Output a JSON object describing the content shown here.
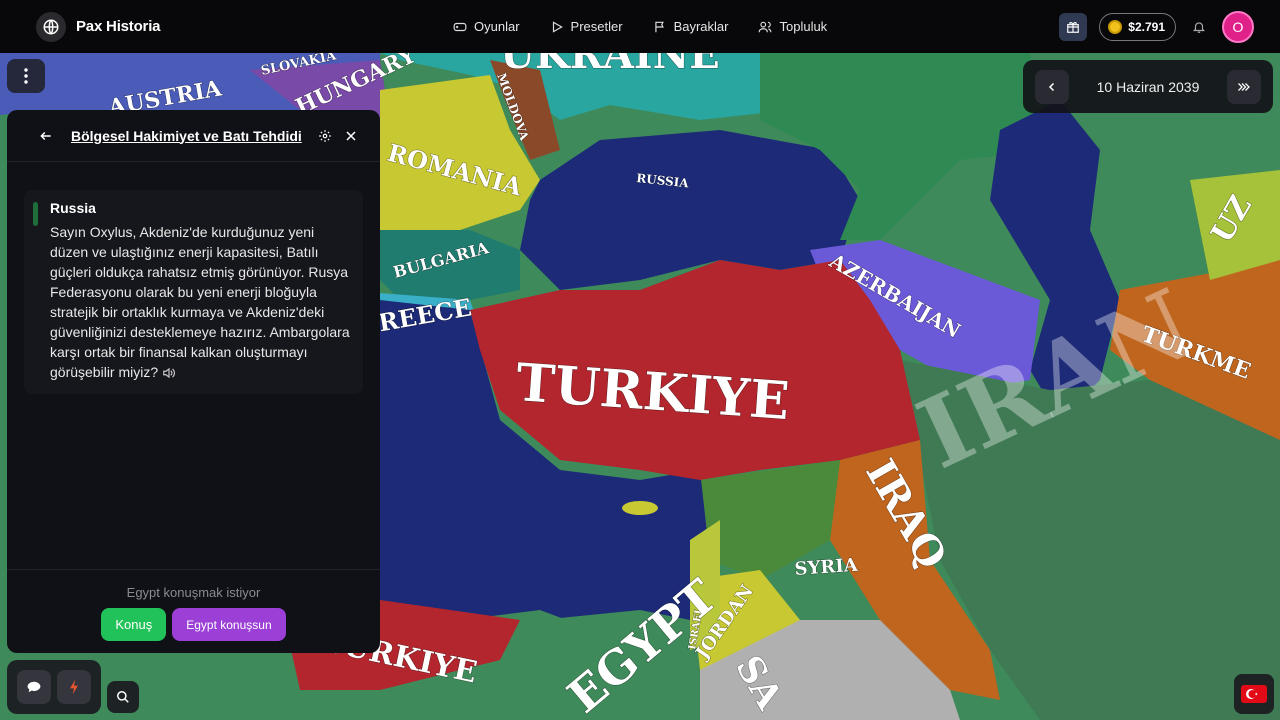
{
  "app": {
    "name": "Pax Historia"
  },
  "nav": {
    "games": "Oyunlar",
    "presets": "Presetler",
    "flags": "Bayraklar",
    "community": "Topluluk"
  },
  "account": {
    "balance": "$2.791",
    "avatar_initial": "O"
  },
  "date": {
    "current": "10 Haziran 2039"
  },
  "panel": {
    "title": "Bölgesel Hakimiyet ve Batı Tehdidi",
    "message": {
      "sender": "Russia",
      "text": "Sayın Oxylus, Akdeniz'de kurduğunuz yeni düzen ve ulaştığınız enerji kapasitesi, Batılı güçleri oldukça rahatsız etmiş görünüyor. Rusya Federasyonu olarak bu yeni enerji bloğuyla stratejik bir ortaklık kurmaya ve Akdeniz'deki güvenliğinizi desteklemeye hazırız. Ambargolara karşı ortak bir finansal kalkan oluşturmayı görüşebilir miyiz?",
      "accent_color": "#1f6e3a"
    },
    "footer_note": "Egypt konuşmak istiyor",
    "talk_button": "Konuş",
    "let_talk_button": "Egypt konuşsun"
  },
  "map_labels": {
    "ukraine": "UKRAINE",
    "slovakia": "SLOVAKIA",
    "austria": "AUSTRIA",
    "hungary": "HUNGARY",
    "moldova": "MOLDOVA",
    "romania": "ROMANIA",
    "russia": "RUSSIA",
    "bulgaria": "BULGARIA",
    "greece": "GREECE",
    "turkiye": "TURKIYE",
    "turkiye_south": "TURKIYE",
    "azerbaijan": "AZERBAIJAN",
    "turkmenistan": "TURKME",
    "uzbekistan": "UZ",
    "iran": "IRAN",
    "iraq": "IRAQ",
    "syria": "SYRIA",
    "jordan": "JORDAN",
    "israel": "ISRAEL",
    "egypt": "EGYPT",
    "saudi": "SA"
  },
  "colors": {
    "turkiye": "#b3262e",
    "sea": "#1c2a78",
    "accent_green": "#22c25a",
    "accent_purple": "#9b3fd6",
    "avatar": "#e0218a"
  }
}
